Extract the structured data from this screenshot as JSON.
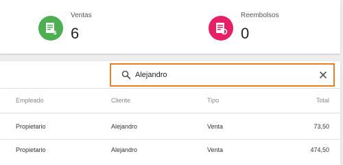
{
  "summary": {
    "sales": {
      "label": "Ventas",
      "value": "6",
      "icon": "receipt-dollar-icon",
      "color": "#4caf50"
    },
    "refunds": {
      "label": "Reembolsos",
      "value": "0",
      "icon": "receipt-refund-icon",
      "color": "#e91e63"
    }
  },
  "search": {
    "value": "Alejandro",
    "accent": "#ef7d22"
  },
  "table": {
    "headers": {
      "employee": "Empleado",
      "client": "Cliente",
      "type": "Tipo",
      "total": "Total"
    },
    "rows": [
      {
        "employee": "Propietario",
        "client": "Alejandro",
        "type": "Venta",
        "total": "73,50"
      },
      {
        "employee": "Propietario",
        "client": "Alejandro",
        "type": "Venta",
        "total": "474,50"
      }
    ]
  }
}
